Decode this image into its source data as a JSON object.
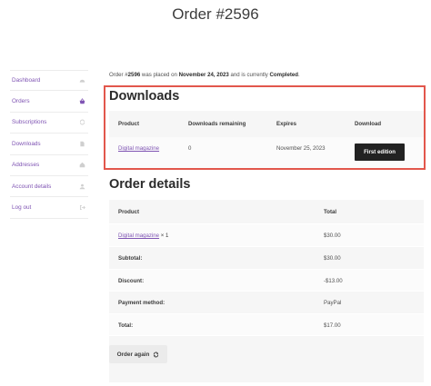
{
  "page": {
    "title": "Order #2596"
  },
  "sidebar": {
    "items": [
      {
        "label": "Dashboard",
        "icon": "gauge-icon"
      },
      {
        "label": "Orders",
        "icon": "basket-icon"
      },
      {
        "label": "Subscriptions",
        "icon": "refresh-icon"
      },
      {
        "label": "Downloads",
        "icon": "file-icon"
      },
      {
        "label": "Addresses",
        "icon": "home-icon"
      },
      {
        "label": "Account details",
        "icon": "user-icon"
      },
      {
        "label": "Log out",
        "icon": "logout-icon"
      }
    ]
  },
  "status": {
    "prefix": "Order #",
    "order_number": "2596",
    "middle": " was placed on ",
    "date": "November 24, 2023",
    "middle2": " and is currently ",
    "state": "Completed",
    "suffix": "."
  },
  "downloads": {
    "title": "Downloads",
    "headers": {
      "product": "Product",
      "remaining": "Downloads remaining",
      "expires": "Expires",
      "download": "Download"
    },
    "row": {
      "product": "Digital magazine",
      "remaining": "0",
      "expires": "November 25, 2023",
      "button": "First edition"
    }
  },
  "order_details": {
    "title": "Order details",
    "headers": {
      "product": "Product",
      "total": "Total"
    },
    "item": {
      "product": "Digital magazine",
      "qty": "× 1",
      "total": "$30.00"
    },
    "rows": [
      {
        "label": "Subtotal:",
        "value": "$30.00"
      },
      {
        "label": "Discount:",
        "value": "-$13.00"
      },
      {
        "label": "Payment method:",
        "value": "PayPal"
      },
      {
        "label": "Total:",
        "value": "$17.00"
      }
    ],
    "order_again_label": "Order again"
  },
  "colors": {
    "accent": "#7f54b3",
    "highlight_border": "#e2574c",
    "button_dark": "#222222"
  }
}
